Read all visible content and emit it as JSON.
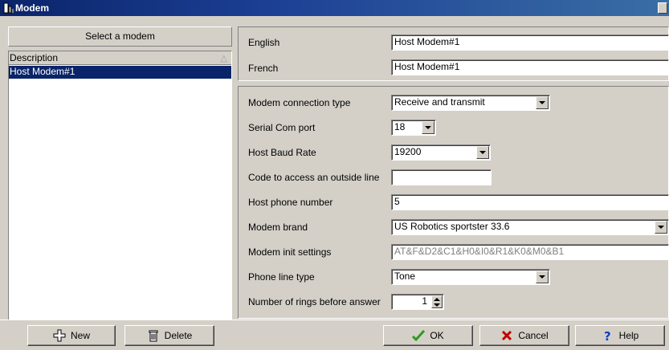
{
  "window": {
    "title": "Modem"
  },
  "left_panel": {
    "select_header": "Select a modem",
    "list_header": "Description",
    "items": [
      "Host Modem#1"
    ]
  },
  "languages": [
    {
      "label": "English",
      "value": "Host Modem#1"
    },
    {
      "label": "French",
      "value": "Host Modem#1"
    }
  ],
  "settings": {
    "connection_type": {
      "label": "Modem connection type",
      "value": "Receive and transmit"
    },
    "com_port": {
      "label": "Serial Com port",
      "value": "18"
    },
    "baud_rate": {
      "label": "Host Baud Rate",
      "value": "19200"
    },
    "outside_line": {
      "label": "Code to access an outside line",
      "value": ""
    },
    "phone_number": {
      "label": "Host phone number",
      "value": "5"
    },
    "brand": {
      "label": "Modem brand",
      "value": "US Robotics sportster 33.6"
    },
    "init": {
      "label": "Modem init settings",
      "value": "AT&F&D2&C1&H0&I0&R1&K0&M0&B1"
    },
    "line_type": {
      "label": "Phone line type",
      "value": "Tone"
    },
    "rings": {
      "label": "Number of rings before answer",
      "value": "1"
    }
  },
  "buttons": {
    "new": "New",
    "delete": "Delete",
    "ok": "OK",
    "cancel": "Cancel",
    "help": "Help"
  },
  "colors": {
    "titlebar": "#0a246a",
    "selection": "#0a246a",
    "face": "#d4d0c8",
    "ok_check": "#2e9a1e",
    "cancel_x": "#c00000",
    "help_mark": "#1040c0"
  }
}
